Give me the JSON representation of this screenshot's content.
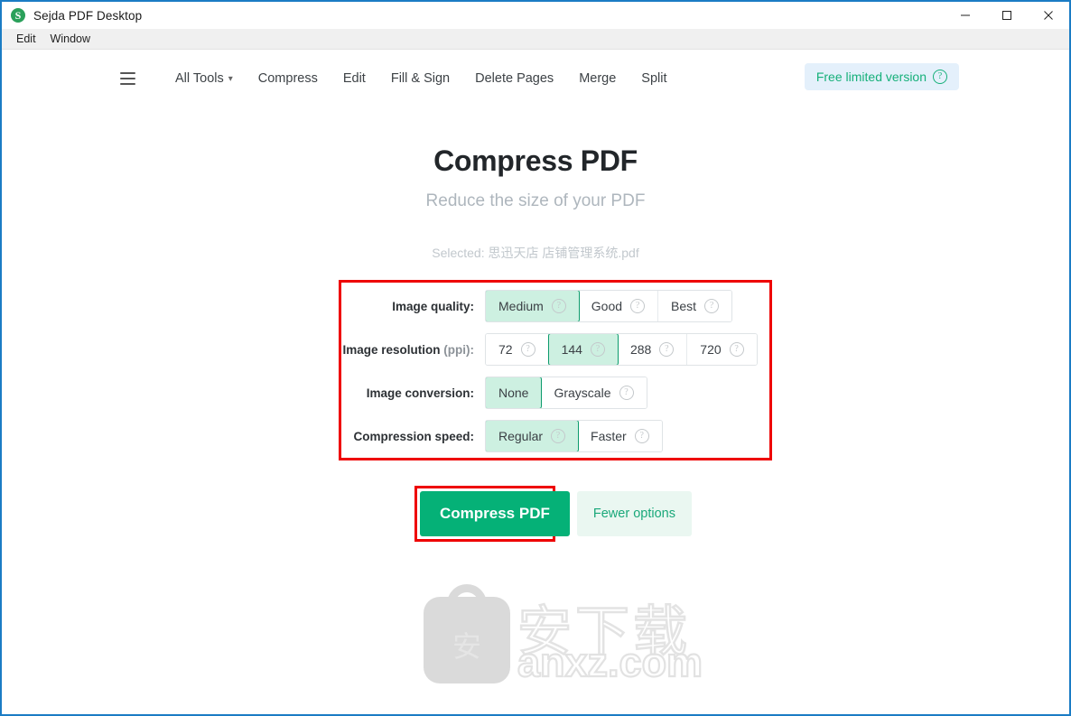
{
  "window": {
    "title": "Sejda PDF Desktop",
    "logo_letter": "S",
    "controls": [
      {
        "name": "minimize-button",
        "glyph": "─"
      },
      {
        "name": "maximize-button",
        "glyph": "□"
      },
      {
        "name": "close-button",
        "glyph": "✕"
      }
    ]
  },
  "menubar": {
    "items": [
      {
        "label": "Edit"
      },
      {
        "label": "Window"
      }
    ]
  },
  "toolbar": {
    "menu_icon": "hamburger-icon",
    "items": [
      {
        "label": "All Tools",
        "has_caret": true
      },
      {
        "label": "Compress",
        "has_caret": false
      },
      {
        "label": "Edit",
        "has_caret": false
      },
      {
        "label": "Fill & Sign",
        "has_caret": false
      },
      {
        "label": "Delete Pages",
        "has_caret": false
      },
      {
        "label": "Merge",
        "has_caret": false
      },
      {
        "label": "Split",
        "has_caret": false
      }
    ],
    "badge": {
      "label": "Free limited version",
      "help_icon": "question-circle-icon",
      "text_color": "#16b07a",
      "background": "#e4f0fb"
    }
  },
  "main": {
    "title": "Compress PDF",
    "subtitle": "Reduce the size of your PDF",
    "selected_file": "Selected: 思迅天店 店铺管理系统.pdf",
    "options": [
      {
        "label": "Image quality:",
        "label_suffix": "",
        "choices": [
          {
            "label": "Medium",
            "selected": true,
            "help": true
          },
          {
            "label": "Good",
            "selected": false,
            "help": true
          },
          {
            "label": "Best",
            "selected": false,
            "help": true
          }
        ]
      },
      {
        "label": "Image resolution ",
        "label_suffix": "(ppi):",
        "choices": [
          {
            "label": "72",
            "selected": false,
            "help": true
          },
          {
            "label": "144",
            "selected": true,
            "help": true
          },
          {
            "label": "288",
            "selected": false,
            "help": true
          },
          {
            "label": "720",
            "selected": false,
            "help": true
          }
        ]
      },
      {
        "label": "Image conversion:",
        "label_suffix": "",
        "choices": [
          {
            "label": "None",
            "selected": true,
            "help": false
          },
          {
            "label": "Grayscale",
            "selected": false,
            "help": true
          }
        ]
      },
      {
        "label": "Compression speed:",
        "label_suffix": "",
        "choices": [
          {
            "label": "Regular",
            "selected": true,
            "help": true
          },
          {
            "label": "Faster",
            "selected": false,
            "help": true
          }
        ]
      }
    ],
    "primary_button": "Compress PDF",
    "secondary_button": "Fewer options"
  },
  "annotations": {
    "color": "#ee0000",
    "boxes": [
      "options-panel",
      "compress-pdf-button"
    ]
  },
  "watermark": {
    "badge_char": "安",
    "decorative_chars": "安下载",
    "site": "anxz.com"
  },
  "colors": {
    "accent_green": "#05b177",
    "selected_fill": "#cdf0e1",
    "selected_border": "#0c9b6c",
    "window_border": "#1b7cc4"
  }
}
